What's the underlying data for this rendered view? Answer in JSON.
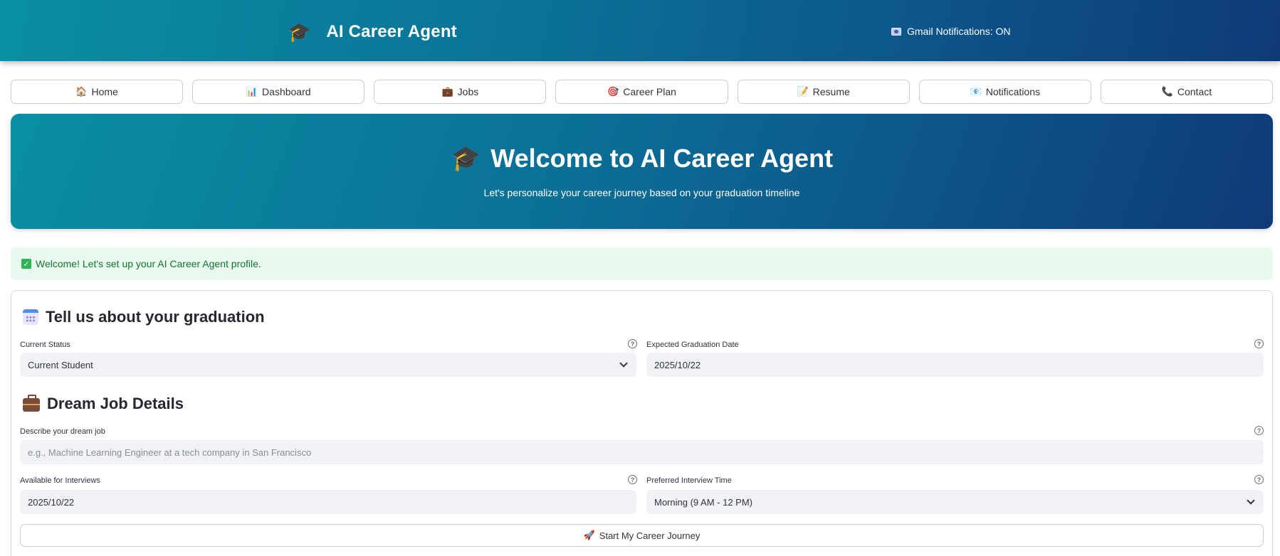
{
  "header": {
    "brand_icon": "graduation-cap-icon",
    "title": "AI Career Agent",
    "status_icon": "mail-icon",
    "status_text": "Gmail Notifications: ON"
  },
  "nav": {
    "items": [
      {
        "icon": "🏠",
        "label": "Home"
      },
      {
        "icon": "📊",
        "label": "Dashboard"
      },
      {
        "icon": "💼",
        "label": "Jobs"
      },
      {
        "icon": "🎯",
        "label": "Career Plan"
      },
      {
        "icon": "📝",
        "label": "Resume"
      },
      {
        "icon": "📧",
        "label": "Notifications"
      },
      {
        "icon": "📞",
        "label": "Contact"
      }
    ]
  },
  "hero": {
    "icon": "🎓",
    "title": "Welcome to AI Career Agent",
    "subtitle": "Let's personalize your career journey based on your graduation timeline"
  },
  "alert": {
    "text": "Welcome! Let's set up your AI Career Agent profile."
  },
  "form": {
    "graduation_section": {
      "title": "Tell us about your graduation",
      "current_status_label": "Current Status",
      "current_status_value": "Current Student",
      "grad_date_label": "Expected Graduation Date",
      "grad_date_value": "2025/10/22"
    },
    "dream_job_section": {
      "title": "Dream Job Details",
      "dream_job_label": "Describe your dream job",
      "dream_job_placeholder": "e.g., Machine Learning Engineer at a tech company in San Francisco",
      "dream_job_value": "",
      "interview_date_label": "Available for Interviews",
      "interview_date_value": "2025/10/22",
      "interview_time_label": "Preferred Interview Time",
      "interview_time_value": "Morning (9 AM - 12 PM)"
    },
    "submit_icon": "🚀",
    "submit_label": "Start My Career Journey"
  },
  "colors": {
    "header_gradient_start": "#0a8fa3",
    "header_gradient_end": "#0f3a7a",
    "success_bg": "#e8f9ee",
    "success_text": "#177233",
    "input_bg": "#f0f2f6"
  }
}
